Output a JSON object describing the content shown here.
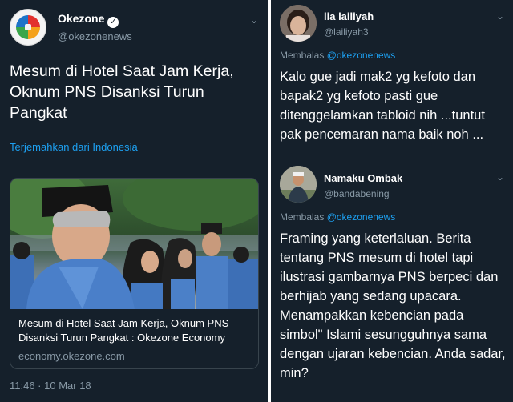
{
  "tweet": {
    "author": {
      "display_name": "Okezone",
      "handle": "@okezonenews",
      "verified_icon": "verified-badge-icon"
    },
    "text": "Mesum di Hotel Saat Jam Kerja, Oknum PNS Disanksi Turun Pangkat",
    "translate_label": "Terjemahkan dari Indonesia",
    "card": {
      "title": "Mesum di Hotel Saat Jam Kerja, Oknum PNS Disanksi Turun Pangkat : Okezone Economy",
      "domain": "economy.okezone.com"
    },
    "timestamp": "11:46 · 10 Mar 18",
    "menu_icon": "chevron-down-icon"
  },
  "replies": [
    {
      "display_name": "lia lailiyah",
      "handle": "@lailiyah3",
      "reply_prefix": "Membalas",
      "reply_target": "@okezonenews",
      "text": "Kalo gue jadi mak2 yg kefoto dan bapak2 yg kefoto pasti gue ditenggelamkan tabloid nih ...tuntut pak pencemaran nama baik noh ..."
    },
    {
      "display_name": "Namaku Ombak",
      "handle": "@bandabening",
      "reply_prefix": "Membalas",
      "reply_target": "@okezonenews",
      "text": "Framing yang keterlaluan. Berita tentang PNS mesum di hotel tapi ilustrasi gambarnya PNS berpeci dan berhijab yang sedang upacara. Menampakkan kebencian pada simbol\" Islami sesungguhnya sama dengan ujaran kebencian. Anda sadar, min?"
    }
  ],
  "colors": {
    "background": "#15202b",
    "accent": "#1da1f2",
    "muted": "#8899a6",
    "border": "#38444d"
  }
}
